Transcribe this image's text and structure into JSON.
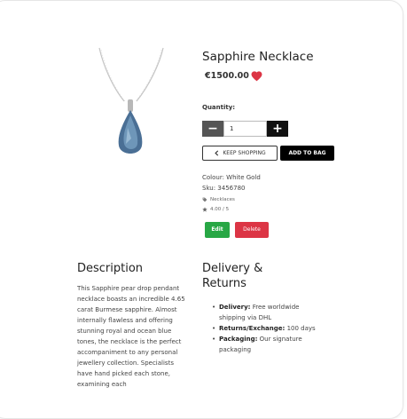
{
  "product": {
    "name": "Sapphire Necklace",
    "price": "€1500.00",
    "quantity_label": "Quantity:",
    "quantity_value": "1",
    "colour": "Colour: White Gold",
    "sku": "Sku: 3456780",
    "category": "Necklaces",
    "rating": "4.00 / 5"
  },
  "buttons": {
    "minus": "−",
    "plus": "+",
    "keep_shopping": "KEEP SHOPPING",
    "add_to_bag": "ADD TO BAG",
    "edit": "Edit",
    "delete": "Delete"
  },
  "description": {
    "heading": "Description",
    "text": "This Sapphire pear drop pendant necklace boasts an incredible 4.65 carat Burmese sapphire. Almost internally flawless and offering stunning royal and ocean blue tones, the necklace is the perfect accompaniment to any personal jewellery collection. Specialists have hand picked each stone, examining each"
  },
  "delivery": {
    "heading_line1": "Delivery &",
    "heading_line2": "Returns",
    "items": [
      {
        "label": "Delivery:",
        "text": "Free worldwide shipping via DHL"
      },
      {
        "label": "Returns/Exchange:",
        "text": "100 days"
      },
      {
        "label": "Packaging:",
        "text": "Our signature packaging"
      }
    ]
  },
  "colors": {
    "heart": "#dc3545",
    "edit": "#28a745",
    "delete": "#dc3545",
    "add_to_bag": "#000000",
    "minus_bg": "#555555",
    "plus_bg": "#111111"
  },
  "icons": {
    "heart": "heart-icon",
    "keep_shopping": "chevron-left-icon",
    "category": "tag-icon",
    "rating": "star-icon"
  }
}
